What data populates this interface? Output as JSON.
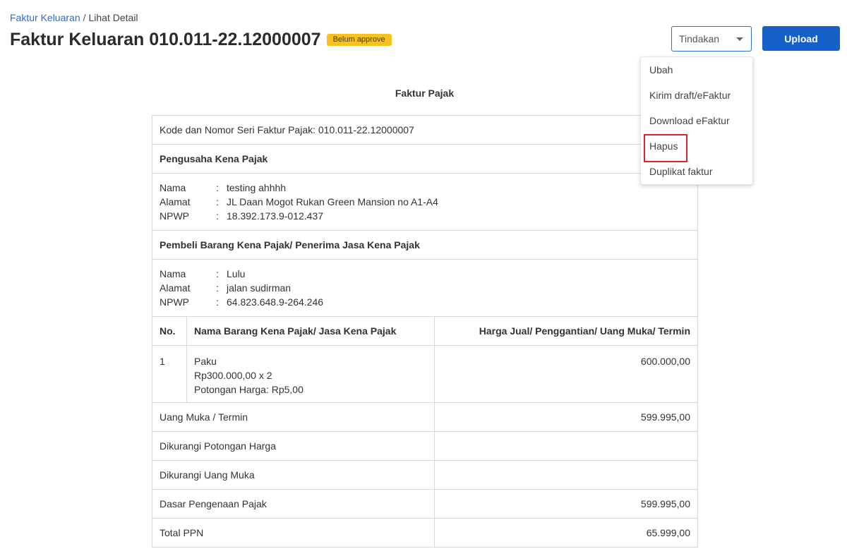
{
  "breadcrumb": {
    "parent": "Faktur Keluaran",
    "separator": "/",
    "current": "Lihat Detail"
  },
  "header": {
    "title": "Faktur Keluaran 010.011-22.12000007",
    "status": "Belum approve"
  },
  "actions": {
    "tindakan_label": "Tindakan",
    "upload_label": "Upload"
  },
  "dropdown_menu": [
    {
      "label": "Ubah"
    },
    {
      "label": "Kirim draft/eFaktur"
    },
    {
      "label": "Download eFaktur"
    },
    {
      "label": "Hapus"
    },
    {
      "label": "Duplikat faktur"
    }
  ],
  "document": {
    "title": "Faktur Pajak",
    "kode_seri": "Kode dan Nomor Seri Faktur Pajak: 010.011-22.12000007",
    "penjual": {
      "heading": "Pengusaha Kena Pajak",
      "nama_label": "Nama",
      "nama": "testing ahhhh",
      "alamat_label": "Alamat",
      "alamat": "JL Daan Mogot Rukan Green Mansion no A1-A4",
      "npwp_label": "NPWP",
      "npwp": "18.392.173.9-012.437"
    },
    "pembeli": {
      "heading": "Pembeli Barang Kena Pajak/ Penerima Jasa Kena Pajak",
      "nama_label": "Nama",
      "nama": "Lulu",
      "alamat_label": "Alamat",
      "alamat": "jalan sudirman",
      "npwp_label": "NPWP",
      "npwp": "64.823.648.9-264.246"
    },
    "columns": {
      "no": "No.",
      "nama_barang": "Nama Barang Kena Pajak/ Jasa Kena Pajak",
      "harga": "Harga Jual/ Penggantian/ Uang Muka/ Termin"
    },
    "items": [
      {
        "no": "1",
        "nama": "Paku",
        "detail": "Rp300.000,00 x 2",
        "potongan": "Potongan Harga: Rp5,00",
        "harga": "600.000,00"
      }
    ],
    "summary": [
      {
        "label": "Uang Muka / Termin",
        "value": "599.995,00"
      },
      {
        "label": "Dikurangi Potongan Harga",
        "value": ""
      },
      {
        "label": "Dikurangi Uang Muka",
        "value": ""
      },
      {
        "label": "Dasar Pengenaan Pajak",
        "value": "599.995,00"
      },
      {
        "label": "Total PPN",
        "value": "65.999,00"
      }
    ]
  }
}
